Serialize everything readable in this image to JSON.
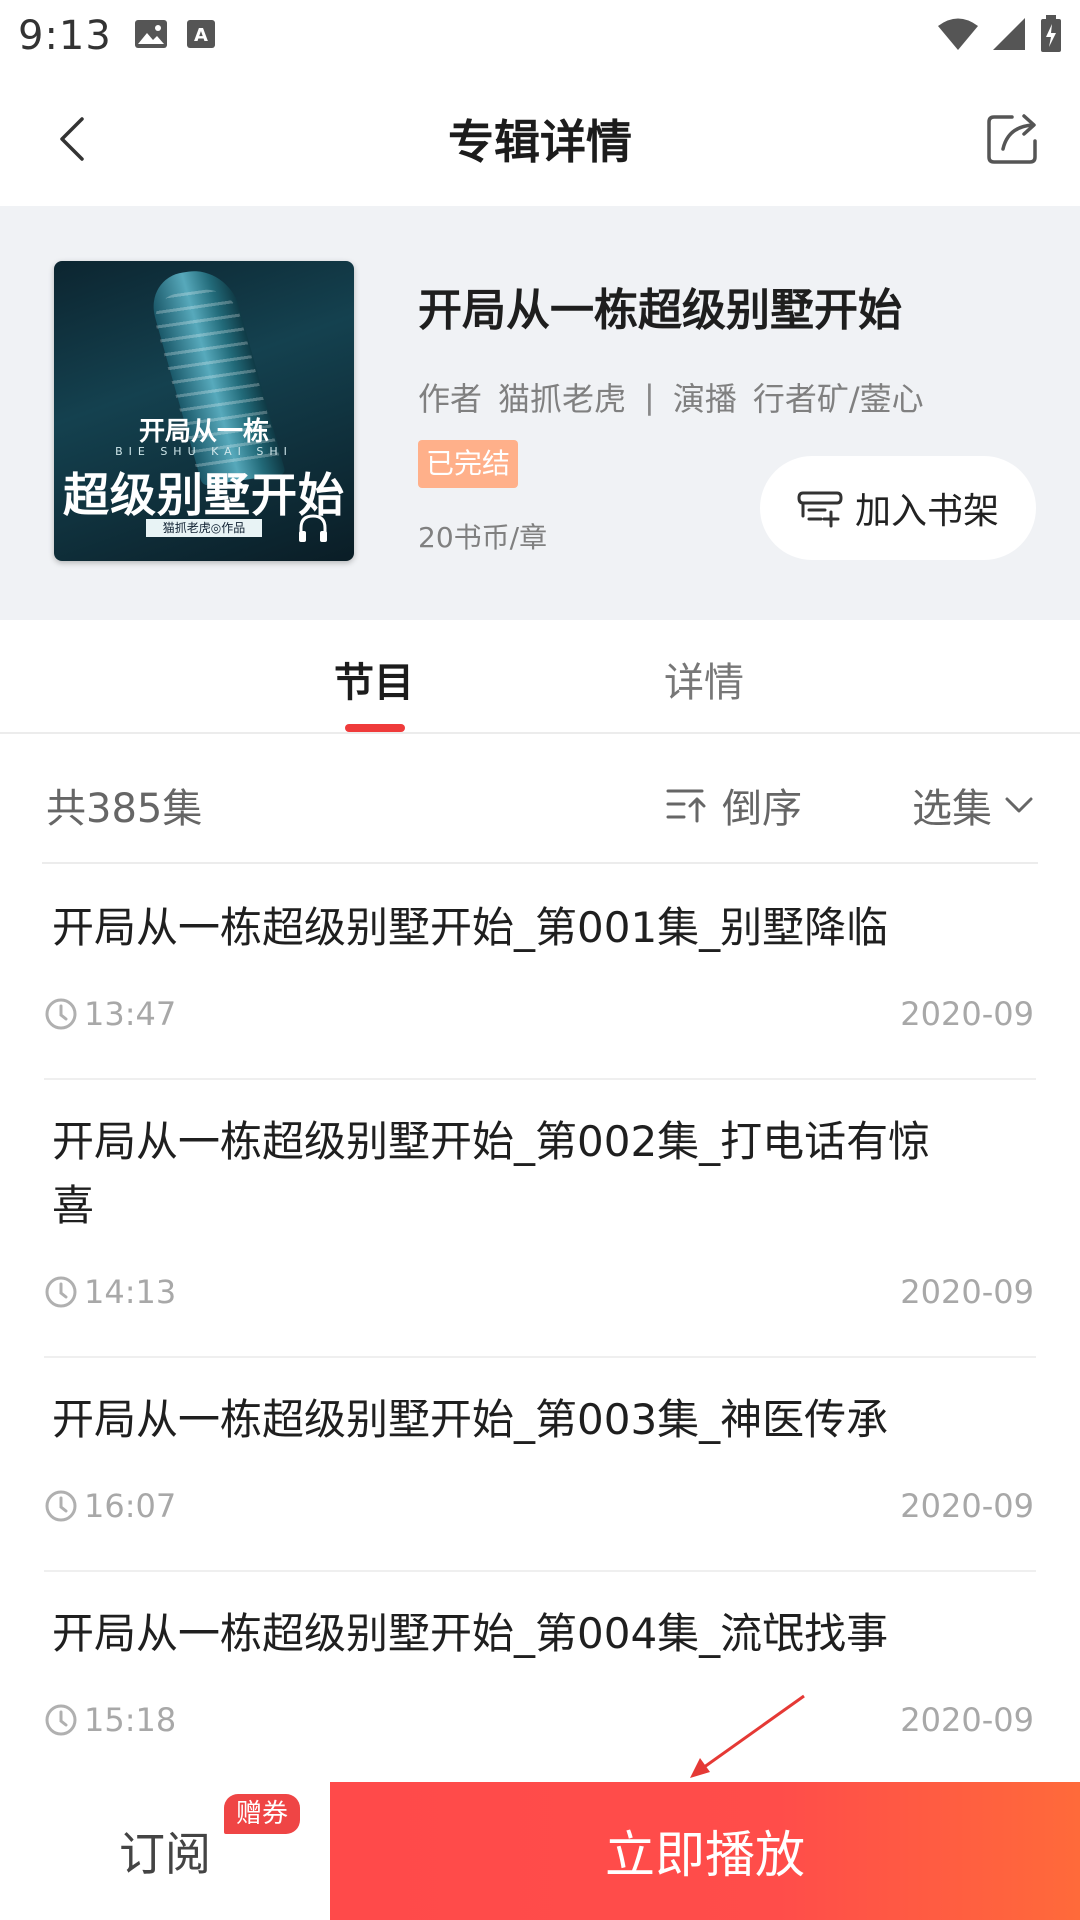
{
  "status_bar": {
    "time": "9:13"
  },
  "header": {
    "title": "专辑详情"
  },
  "album": {
    "title": "开局从一栋超级别墅开始",
    "author_label": "作者",
    "author": "猫抓老虎",
    "narrator_label": "演播",
    "narrator": "行者矿/蓥心",
    "status_badge": "已完结",
    "price": "20书币/章",
    "add_shelf_label": "加入书架",
    "cover": {
      "line1": "开局从一栋",
      "line2": "BIE SHU KAI SHI",
      "line3": "超级别墅开始",
      "line4": "猫抓老虎◎作品"
    }
  },
  "tabs": [
    {
      "label": "节目",
      "active": true
    },
    {
      "label": "详情",
      "active": false
    }
  ],
  "list_header": {
    "count": "共385集",
    "order_label": "倒序",
    "pick_label": "选集"
  },
  "episodes": [
    {
      "title": "开局从一栋超级别墅开始_第001集_别墅降临",
      "duration": "13:47",
      "date": "2020-09"
    },
    {
      "title": "开局从一栋超级别墅开始_第002集_打电话有惊喜",
      "duration": "14:13",
      "date": "2020-09"
    },
    {
      "title": "开局从一栋超级别墅开始_第003集_神医传承",
      "duration": "16:07",
      "date": "2020-09"
    },
    {
      "title": "开局从一栋超级别墅开始_第004集_流氓找事",
      "duration": "15:18",
      "date": "2020-09"
    }
  ],
  "bottom_bar": {
    "subscribe_label": "订阅",
    "coupon_label": "赠券",
    "play_label": "立即播放"
  },
  "colors": {
    "accent_red": "#ef3b3b",
    "badge_orange": "#ffb08a",
    "play_gradient_start": "#ff4a4a",
    "play_gradient_end": "#ff6a3a"
  }
}
